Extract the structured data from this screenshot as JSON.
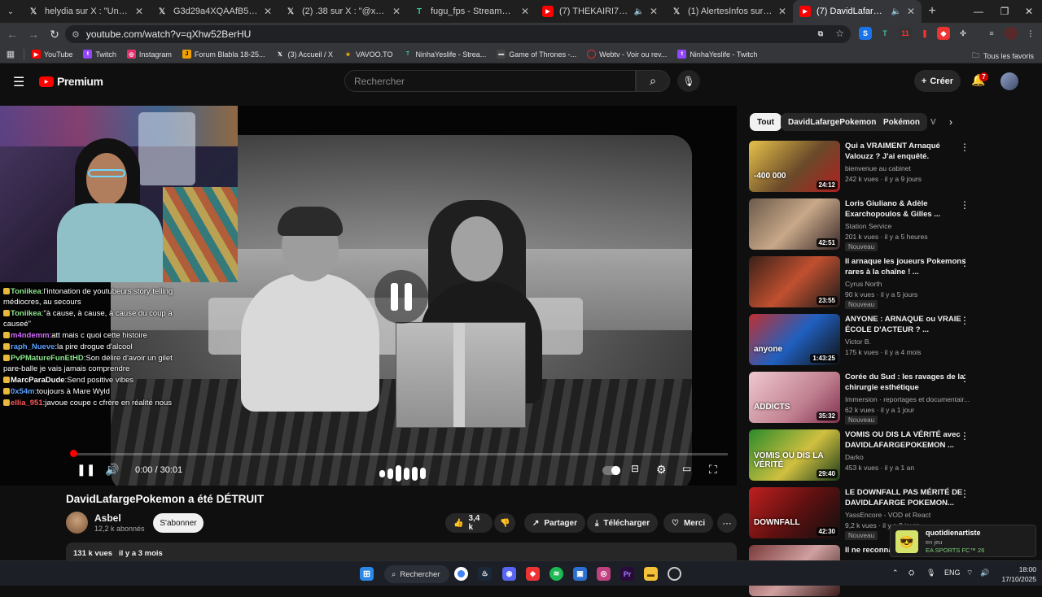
{
  "browser": {
    "tabs": [
      {
        "label": "helydia sur X : \"Un message",
        "icon": "x-logo"
      },
      {
        "label": "G3d29a4XQAAfB5R (1253×16",
        "icon": "x-logo"
      },
      {
        "label": "(2) .38 sur X : \"@xyanvener @",
        "icon": "x-logo"
      },
      {
        "label": "fugu_fps - Streamer Overview",
        "icon": "tracker-logo"
      },
      {
        "label": "(7) THEKAIRI78 EN DANGE",
        "icon": "youtube-logo"
      },
      {
        "label": "(1) AlertesInfos sur X : \"ra \"Ça",
        "icon": "x-logo"
      },
      {
        "label": "(7) DavidLafargePokemon",
        "icon": "youtube-logo"
      }
    ],
    "url": "youtube.com/watch?v=qXhw52BerHU",
    "bookmarks": [
      {
        "label": "YouTube",
        "color": "#ff0000"
      },
      {
        "label": "Twitch",
        "color": "#9146ff"
      },
      {
        "label": "Instagram",
        "color": "#e1306c"
      },
      {
        "label": "Forum Blabla 18-25...",
        "color": "#f0a000"
      },
      {
        "label": "(3) Accueil / X",
        "color": "#ffffff"
      },
      {
        "label": "VAVOO.TO",
        "color": "#f5b000"
      },
      {
        "label": "NinhaYeslife - Strea...",
        "color": "#3cc48a"
      },
      {
        "label": "Game of Thrones -...",
        "color": "#888888"
      },
      {
        "label": "Webtv - Voir ou rev...",
        "color": "#cc3333"
      },
      {
        "label": "NinhaYeslife - Twitch",
        "color": "#9146ff"
      }
    ],
    "all_bookmarks_label": "Tous les favoris"
  },
  "youtube": {
    "logo_label": "Premium",
    "search_placeholder": "Rechercher",
    "create_label": "Créer",
    "notification_count": "7"
  },
  "player": {
    "time": "0:00 / 30:01",
    "progress_fraction": 0.0
  },
  "stream_chat": [
    {
      "user": "Toniikea",
      "user_color": "#8fe88f",
      "text": "l'intonation de youtubeurs story telling médiocres, au secours"
    },
    {
      "user": "Toniikea",
      "user_color": "#8fe88f",
      "text": "\"à cause, à cause, à cause du coup à causeé\""
    },
    {
      "user": "m4ndemm",
      "user_color": "#d26cff",
      "text": "att mais c quoi cette histoire"
    },
    {
      "user": "raph_Nueve",
      "user_color": "#5aa0ff",
      "text": "la pire drogue d'alcool"
    },
    {
      "user": "PvPMatureFunEtHD",
      "user_color": "#8fe88f",
      "text": "Son délire d'avoir un gilet pare-balle je vais jamais comprendre"
    },
    {
      "user": "MarcParaDude",
      "user_color": "#ffffff",
      "text": "Send positive vibes"
    },
    {
      "user": "0x54m",
      "user_color": "#5aa0ff",
      "text": "toujours à Mare Wyld"
    },
    {
      "user": "ellia_951",
      "user_color": "#ff5a5a",
      "text": "javoue coupe c cfrère en réalité nous"
    }
  ],
  "video": {
    "title": "DavidLafargePokemon a été DÉTRUIT",
    "channel": "Asbel",
    "subscribers": "12,2 k abonnés",
    "subscribe_label": "S'abonner",
    "likes": "3,4 k",
    "share_label": "Partager",
    "download_label": "Télécharger",
    "thanks_label": "Merci",
    "views_date": "131 k vues   il y a 3 mois"
  },
  "chips": [
    "Tout",
    "DavidLafargePokemon",
    "Pokémon",
    "V"
  ],
  "recommendations": [
    {
      "title": "Qui a VRAIMENT Arnaqué Valouzz ? J'ai enquêté.",
      "channel": "bienvenue au cabinet",
      "meta": "242 k vues · il y a 9 jours",
      "duration": "24:12",
      "badge": "",
      "thumb_overlay": "-400 000"
    },
    {
      "title": "Loris Giuliano & Adèle Exarchopoulos & Gilles ...",
      "channel": "Station Service",
      "meta": "201 k vues · il y a 5 heures",
      "duration": "42:51",
      "badge": "Nouveau",
      "thumb_overlay": ""
    },
    {
      "title": "Il arnaque les joueurs Pokemons rares à la chaîne ! ...",
      "channel": "Cyrus North",
      "meta": "90 k vues · il y a 5 jours",
      "duration": "23:55",
      "badge": "Nouveau",
      "thumb_overlay": ""
    },
    {
      "title": "ANYONE : ARNAQUE ou VRAIE ÉCOLE D'ACTEUR ? ...",
      "channel": "Victor B.",
      "meta": "175 k vues · il y a 4 mois",
      "duration": "1:43:25",
      "badge": "",
      "thumb_overlay": "anyone"
    },
    {
      "title": "Corée du Sud : les ravages de la chirurgie esthétique",
      "channel": "Immersion · reportages et documentair...",
      "meta": "62 k vues · il y a 1 jour",
      "duration": "35:32",
      "badge": "Nouveau",
      "thumb_overlay": "ADDICTS"
    },
    {
      "title": "VOMIS OU DIS LA VÉRITÉ avec DAVIDLAFARGEPOKEMON ...",
      "channel": "Darko",
      "meta": "453 k vues · il y a 1 an",
      "duration": "29:40",
      "badge": "",
      "thumb_overlay": "VOMIS OU DIS LA VÉRITÉ"
    },
    {
      "title": "LE DOWNFALL PAS MÉRITÉ DE DAVIDLAFARGE POKEMON...",
      "channel": "YassEncore - VOD et React",
      "meta": "9,2 k vues · il y a 9 jours",
      "duration": "42:30",
      "badge": "Nouveau",
      "thumb_overlay": "DOWNFALL"
    },
    {
      "title": "Il ne reconna déguisée et l",
      "channel": "",
      "meta": "",
      "duration": "",
      "badge": "",
      "thumb_overlay": ""
    }
  ],
  "toast": {
    "name": "quotidienartiste",
    "status": "en jeu",
    "game": "EA SPORTS FC™ 26"
  },
  "taskbar": {
    "search_label": "Rechercher",
    "language": "ENG",
    "time": "18:00",
    "date": "17/10/2025"
  }
}
